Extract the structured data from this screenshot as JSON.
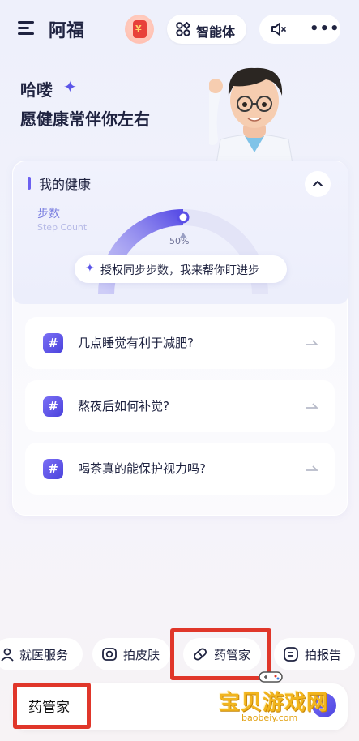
{
  "header": {
    "app_title": "阿福",
    "agent_label": "智能体",
    "icons": [
      "menu-icon",
      "red-envelope-icon",
      "agent-icon",
      "mute-icon",
      "more-icon"
    ]
  },
  "greeting": {
    "line1": "哈喽",
    "line2": "愿健康常伴你左右"
  },
  "health_card": {
    "title": "我的健康",
    "steps_label": "步数",
    "steps_sub": "Step Count",
    "progress_text": "50%",
    "progress_fraction": 0.5,
    "auth_text": "授权同步步数，我来帮你盯进步"
  },
  "questions": [
    {
      "text": "几点睡觉有利于减肥?"
    },
    {
      "text": "熬夜后如何补觉?"
    },
    {
      "text": "喝茶真的能保护视力吗?"
    }
  ],
  "quick_actions": [
    {
      "label": "就医服务",
      "icon": "person-icon"
    },
    {
      "label": "拍皮肤",
      "icon": "camera-icon"
    },
    {
      "label": "药管家",
      "icon": "pill-icon"
    },
    {
      "label": "拍报告",
      "icon": "report-icon"
    }
  ],
  "input": {
    "value": "药管家"
  },
  "watermark": {
    "title": "宝贝游戏网",
    "url": "baobeiy.com"
  },
  "colors": {
    "accent": "#5b55e8",
    "highlight": "#e0362a"
  }
}
